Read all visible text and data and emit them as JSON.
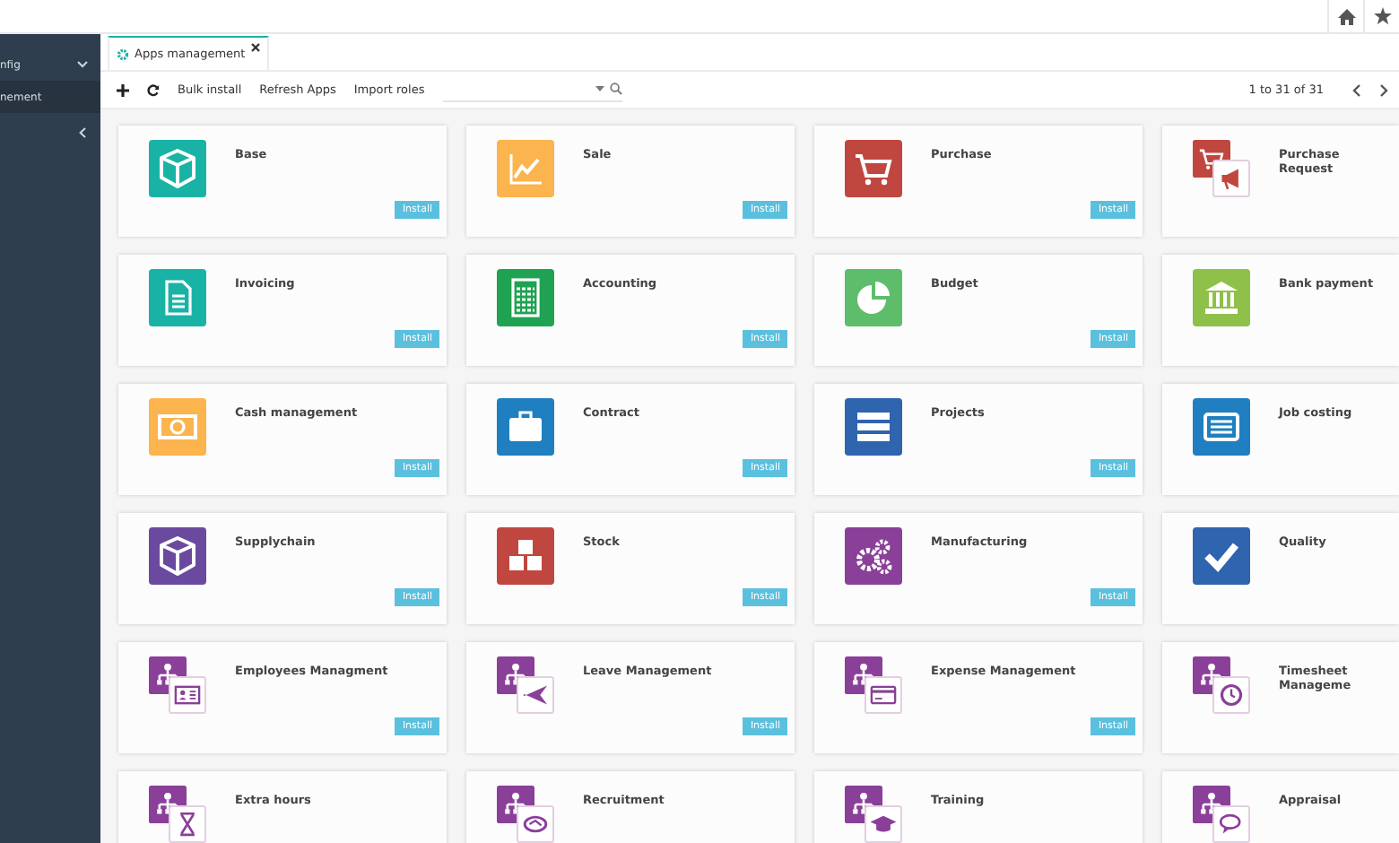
{
  "sidebar": {
    "items": [
      {
        "label": "nfig",
        "selected": false,
        "expandable": true
      },
      {
        "label": "nement",
        "selected": true,
        "expandable": false
      }
    ]
  },
  "tabs": [
    {
      "label": "Apps management",
      "selected": true
    }
  ],
  "toolbar": {
    "actions": [
      "Bulk install",
      "Refresh Apps",
      "Import roles"
    ],
    "pagination": "1 to 31 of 31"
  },
  "apps": [
    {
      "title": "Base",
      "color": "#19b3a6",
      "install": "Install"
    },
    {
      "title": "Sale",
      "color": "#fbb44e",
      "install": "Install"
    },
    {
      "title": "Purchase",
      "color": "#c0473f",
      "install": "Install"
    },
    {
      "title": "Purchase Request",
      "color": "#c0473f"
    },
    {
      "title": "Invoicing",
      "color": "#19b3a6",
      "install": "Install"
    },
    {
      "title": "Accounting",
      "color": "#1fa352",
      "install": "Install"
    },
    {
      "title": "Budget",
      "color": "#5ebd6b",
      "install": "Install"
    },
    {
      "title": "Bank payment",
      "color": "#8fc04a"
    },
    {
      "title": "Cash management",
      "color": "#fbb44e",
      "install": "Install"
    },
    {
      "title": "Contract",
      "color": "#1f7fc0",
      "install": "Install"
    },
    {
      "title": "Projects",
      "color": "#2f64ae",
      "install": "Install"
    },
    {
      "title": "Job costing",
      "color": "#1f7fc0"
    },
    {
      "title": "Supplychain",
      "color": "#6a4a9e",
      "install": "Install"
    },
    {
      "title": "Stock",
      "color": "#c0473f",
      "install": "Install"
    },
    {
      "title": "Manufacturing",
      "color": "#8a3f98",
      "install": "Install"
    },
    {
      "title": "Quality",
      "color": "#2f64ae"
    },
    {
      "title": "Employees Managment",
      "color": "#8a3f98",
      "install": "Install"
    },
    {
      "title": "Leave Management",
      "color": "#8a3f98",
      "install": "Install"
    },
    {
      "title": "Expense Management",
      "color": "#8a3f98",
      "install": "Install"
    },
    {
      "title": "Timesheet Manageme",
      "color": "#8a3f98"
    },
    {
      "title": "Extra hours",
      "color": "#8a3f98"
    },
    {
      "title": "Recruitment",
      "color": "#8a3f98"
    },
    {
      "title": "Training",
      "color": "#8a3f98"
    },
    {
      "title": "Appraisal",
      "color": "#8a3f98"
    }
  ]
}
